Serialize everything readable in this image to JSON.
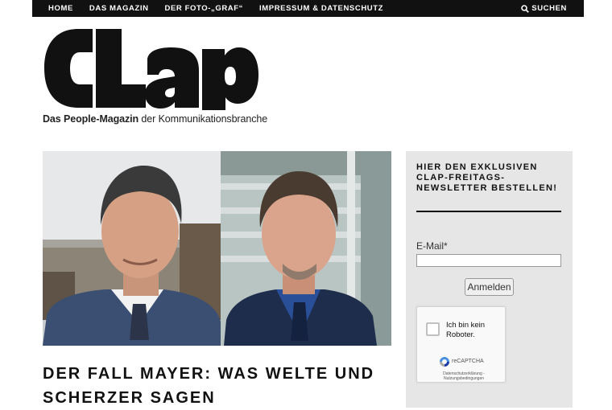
{
  "nav": {
    "items": [
      "HOME",
      "DAS MAGAZIN",
      "DER FOTO-„GRAF“",
      "IMPRESSUM & DATENSCHUTZ"
    ],
    "search_label": "SUCHEN"
  },
  "logo": {
    "text": "CLAP"
  },
  "tagline": {
    "bold": "Das People-Magazin",
    "rest": " der Kommunikationsbranche"
  },
  "article": {
    "headline": "DER FALL MAYER: WAS WELTE UND SCHERZER SAGEN"
  },
  "newsletter": {
    "title": "HIER DEN EXKLUSIVEN CLAP-FREITAGS-NEWSLETTER BESTELLEN!",
    "email_label": "E-Mail*",
    "email_value": "",
    "submit_label": "Anmelden"
  },
  "captcha": {
    "checkbox_label": "Ich bin kein Roboter.",
    "brand": "reCAPTCHA",
    "links": "Datenschutzerklärung - Nutzungsbedingungen"
  },
  "colors": {
    "topbar": "#111111",
    "sidebar": "#e6e6e6",
    "text": "#111111"
  }
}
